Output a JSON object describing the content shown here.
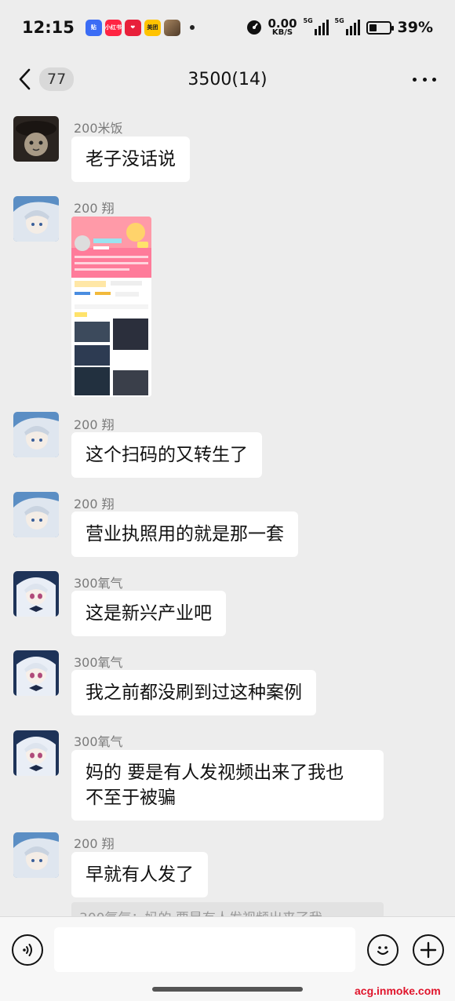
{
  "status_bar": {
    "time": "12:15",
    "apps": [
      {
        "label": "贴",
        "color": "#3b6cf5"
      },
      {
        "label": "小红书",
        "color": "#ff2442"
      },
      {
        "label": "❤",
        "color": "#e8203a"
      },
      {
        "label": "美团",
        "color": "#ffc300"
      },
      {
        "label": "",
        "color": "#8a6a4a"
      }
    ],
    "speed_value": "0.00",
    "speed_unit": "KB/S",
    "signal1_label": "5G",
    "signal2_label": "5G",
    "battery_text": "39%",
    "battery_level": 0.39
  },
  "header": {
    "back_count": "77",
    "title": "3500(14)"
  },
  "messages": [
    {
      "sender": "200米饭",
      "text": "老子没话说",
      "avatar_icon": "cat-avatar"
    },
    {
      "sender": "200 翔",
      "type": "image",
      "avatar_icon": "anime-avatar-blue"
    },
    {
      "sender": "200 翔",
      "text": "这个扫码的又转生了",
      "avatar_icon": "anime-avatar-blue"
    },
    {
      "sender": "200 翔",
      "text": "营业执照用的就是那一套",
      "avatar_icon": "anime-avatar-blue"
    },
    {
      "sender": "300氧气",
      "text": "这是新兴产业吧",
      "avatar_icon": "anime-avatar-white"
    },
    {
      "sender": "300氧气",
      "text": "我之前都没刷到过这种案例",
      "avatar_icon": "anime-avatar-white"
    },
    {
      "sender": "300氧气",
      "text_line1": "妈的 要是有人发视频出来了我也",
      "text_line2": "不至于被骗",
      "avatar_icon": "anime-avatar-white"
    },
    {
      "sender": "200 翔",
      "text": "早就有人发了",
      "avatar_icon": "anime-avatar-blue"
    }
  ],
  "quote_preview": "300氧气：妈的 要是有人发视频出来了我",
  "input": {
    "placeholder": ""
  },
  "watermark": "acg.inmoke.com"
}
